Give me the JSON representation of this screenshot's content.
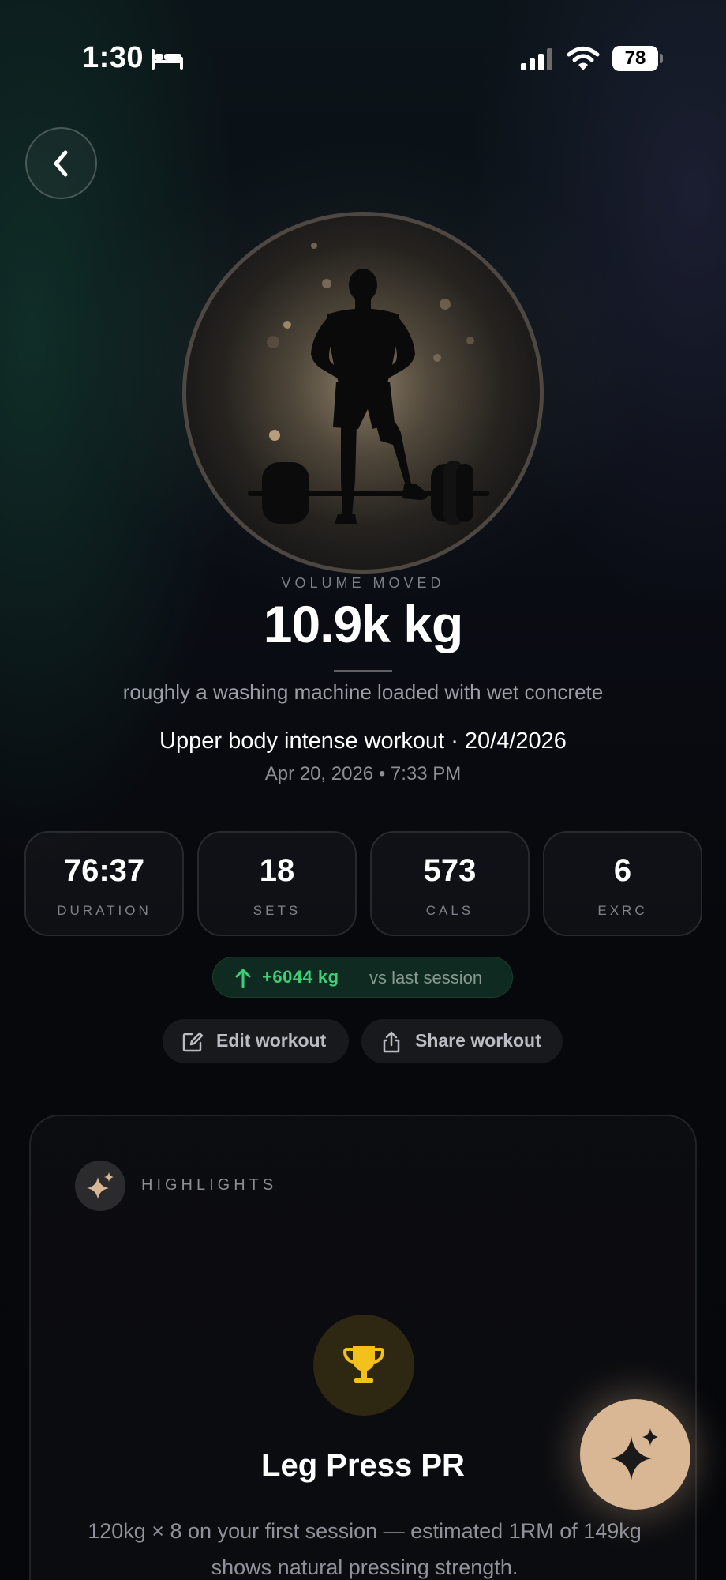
{
  "status_bar": {
    "time": "1:30",
    "battery": "78",
    "icons": [
      "bed-icon",
      "cellular-signal-icon",
      "wifi-icon",
      "battery-icon"
    ]
  },
  "navigation": {
    "back_icon": "chevron-left-icon"
  },
  "hero": {
    "image": "lifter-with-barbell-silhouette",
    "label": "VOLUME MOVED",
    "value": "10.9k kg",
    "comparison": "roughly a washing machine loaded with wet concrete"
  },
  "workout": {
    "title": "Upper body intense workout · 20/4/2026",
    "datetime": "Apr 20, 2026 • 7:33 PM"
  },
  "stats": [
    {
      "value": "76:37",
      "label": "DURATION"
    },
    {
      "value": "18",
      "label": "SETS"
    },
    {
      "value": "573",
      "label": "CALS"
    },
    {
      "value": "6",
      "label": "EXRC"
    }
  ],
  "delta": {
    "icon": "arrow-up-icon",
    "value": "+6044 kg",
    "caption": "vs last session",
    "color": "#3ecf77"
  },
  "actions": {
    "edit": {
      "label": "Edit workout",
      "icon": "edit-icon"
    },
    "share": {
      "label": "Share workout",
      "icon": "share-icon"
    }
  },
  "highlights": {
    "label": "HIGHLIGHTS",
    "icon": "sparkles-icon",
    "item": {
      "icon": "trophy-icon",
      "title": "Leg Press PR",
      "description": "120kg × 8 on your first session — estimated 1RM of 149kg shows natural pressing strength."
    }
  },
  "fab": {
    "icon": "sparkles-icon"
  },
  "colors": {
    "accent": "#d9b795",
    "positive": "#3ecf77",
    "trophy": "#f2c11c",
    "background": "#08090d"
  }
}
